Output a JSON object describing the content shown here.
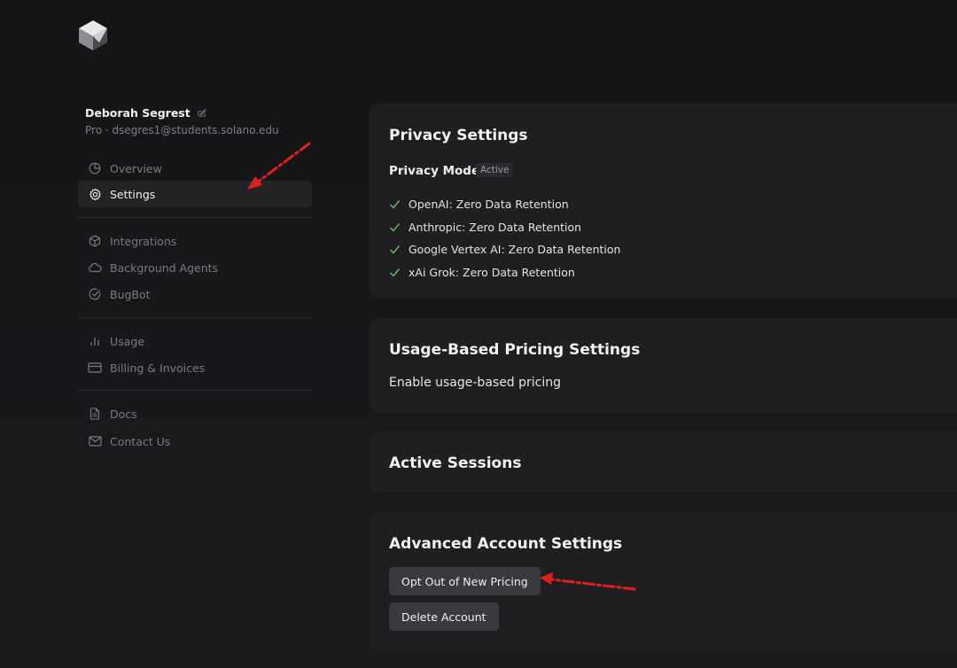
{
  "logo": {
    "icon": "cube-logo-icon"
  },
  "user": {
    "name": "Deborah Segrest",
    "edit_icon": "edit-icon",
    "plan_email": "Pro · dsegres1@students.solano.edu"
  },
  "nav": {
    "groups": [
      [
        {
          "label": "Overview",
          "icon": "pie-chart-icon"
        },
        {
          "label": "Settings",
          "icon": "gear-icon",
          "active": true
        }
      ],
      [
        {
          "label": "Integrations",
          "icon": "box-icon"
        },
        {
          "label": "Background Agents",
          "icon": "cloud-icon"
        },
        {
          "label": "BugBot",
          "icon": "check-circle-icon"
        }
      ],
      [
        {
          "label": "Usage",
          "icon": "bar-chart-icon"
        },
        {
          "label": "Billing & Invoices",
          "icon": "credit-card-icon"
        }
      ],
      [
        {
          "label": "Docs",
          "icon": "document-icon"
        },
        {
          "label": "Contact Us",
          "icon": "mail-icon"
        }
      ]
    ]
  },
  "privacy": {
    "title": "Privacy Settings",
    "mode_label": "Privacy Mode",
    "mode_badge": "Active",
    "items": [
      "OpenAI: Zero Data Retention",
      "Anthropic: Zero Data Retention",
      "Google Vertex AI: Zero Data Retention",
      "xAi Grok: Zero Data Retention"
    ]
  },
  "usage_pricing": {
    "title": "Usage-Based Pricing Settings",
    "toggle_label": "Enable usage-based pricing"
  },
  "sessions": {
    "title": "Active Sessions"
  },
  "advanced": {
    "title": "Advanced Account Settings",
    "opt_out_label": "Opt Out of New Pricing",
    "delete_label": "Delete Account"
  },
  "colors": {
    "background": "#18181b",
    "card": "#1f1f22",
    "active_nav": "#232326",
    "button": "#3a3a3e",
    "check": "#6cc26c",
    "annotation_arrow": "#e02020"
  }
}
